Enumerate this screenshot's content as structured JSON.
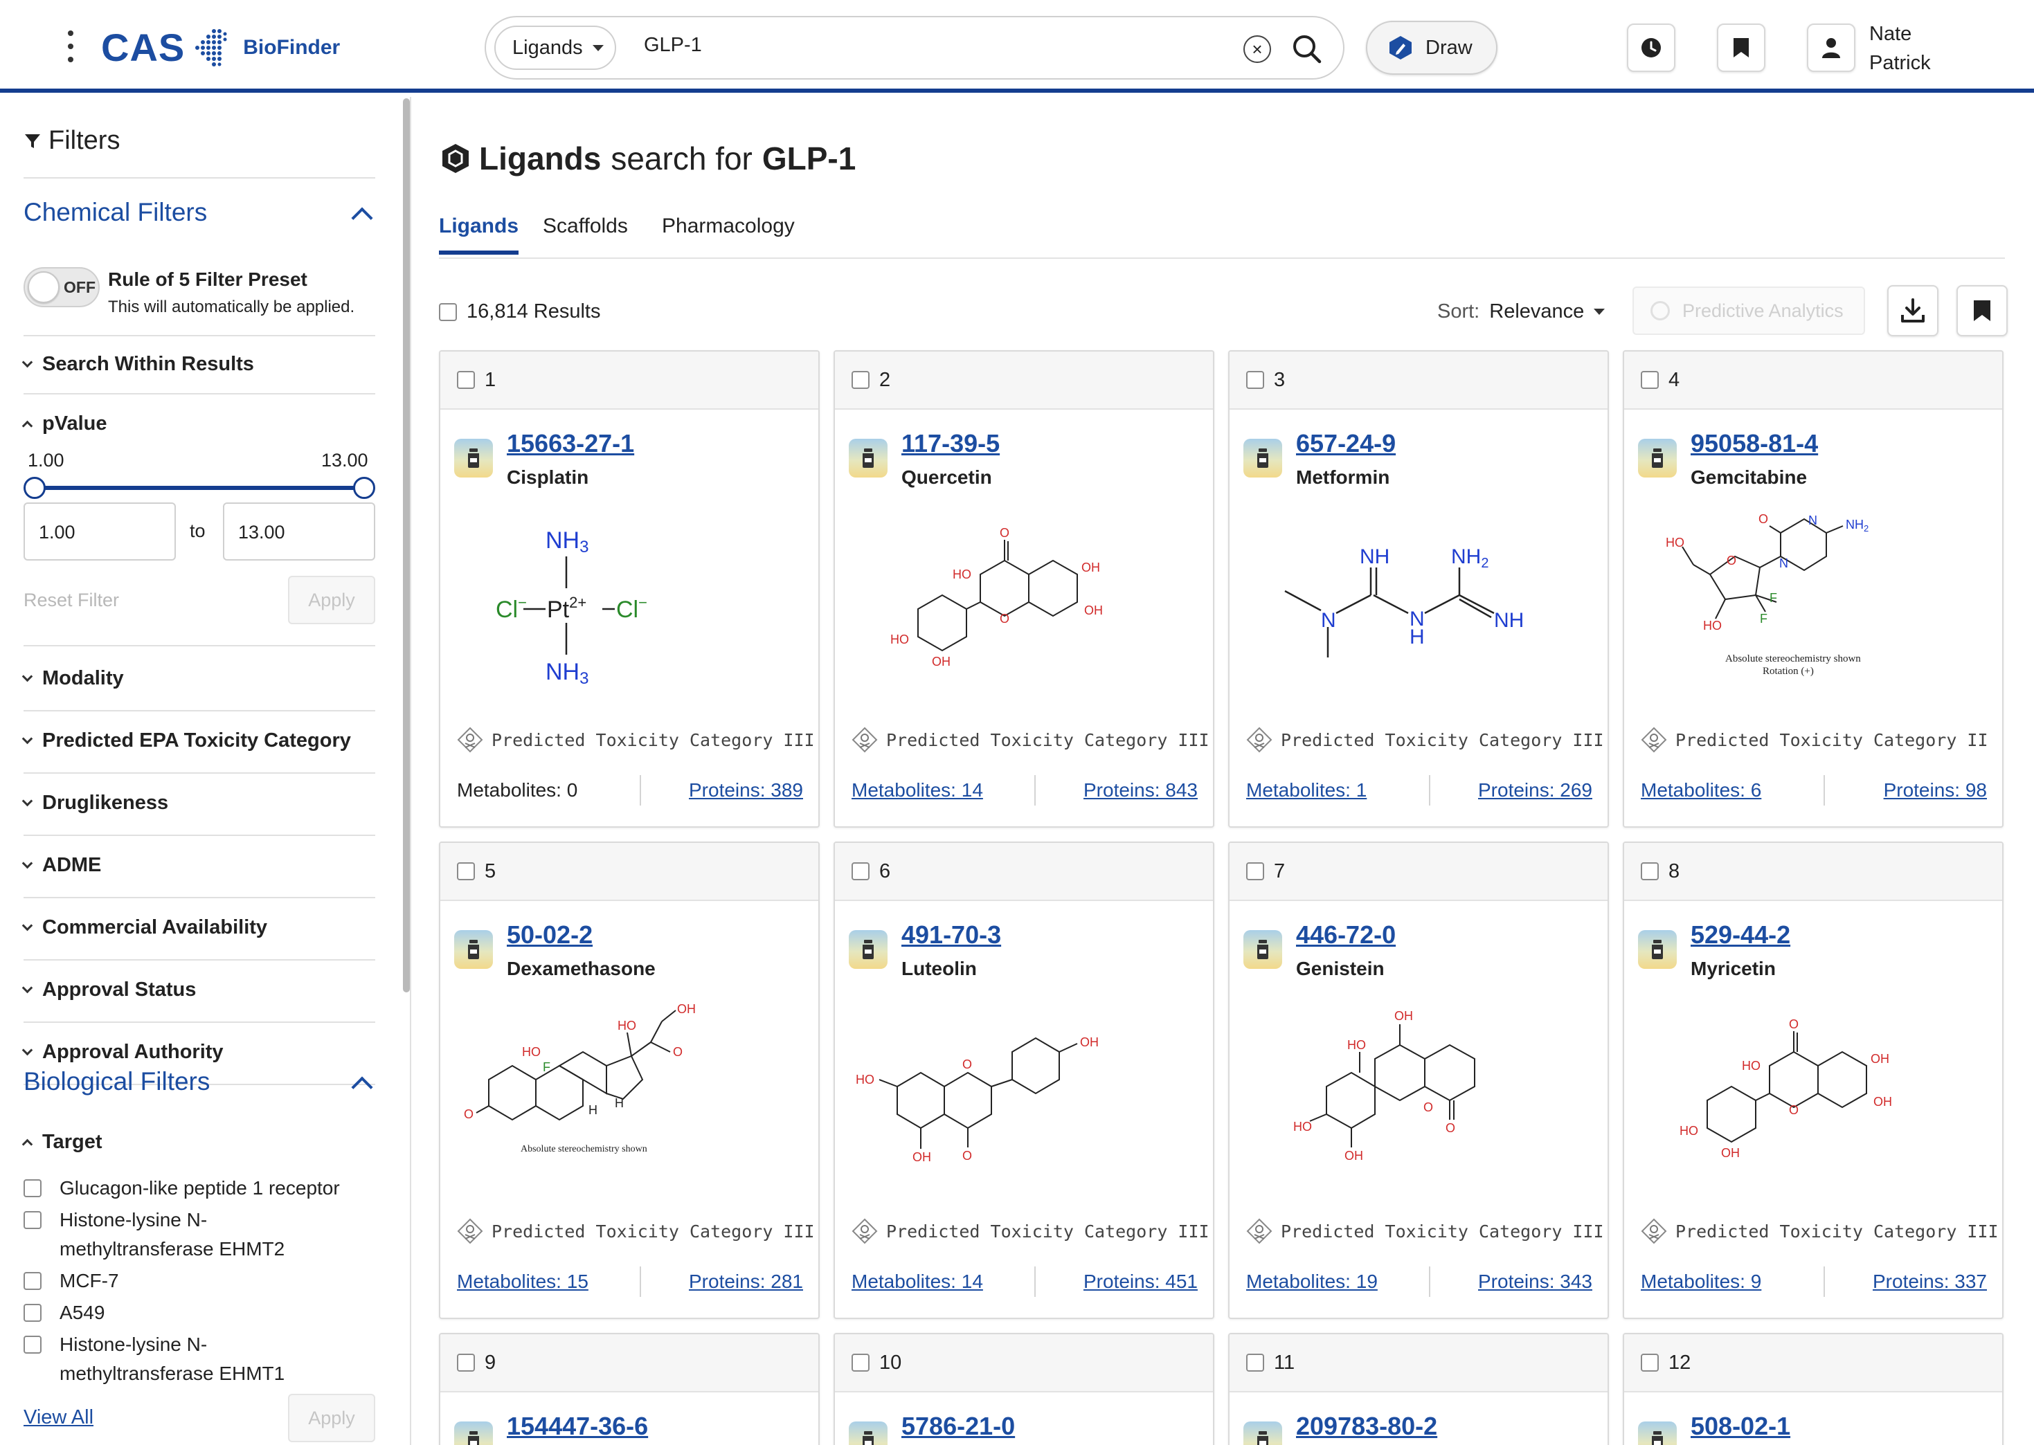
{
  "header": {
    "logo_text": "CAS",
    "logo_sub": "BioFinder",
    "search_type": "Ligands",
    "search_value": "GLP-1",
    "draw_label": "Draw",
    "user_first": "Nate",
    "user_last": "Patrick",
    "accent": "#143d8f"
  },
  "sidebar": {
    "title": "Filters",
    "chemical_title": "Chemical Filters",
    "toggle_state": "OFF",
    "preset_title": "Rule of 5 Filter Preset",
    "preset_sub": "This will automatically be applied.",
    "search_within": "Search Within Results",
    "pvalue": {
      "label": "pValue",
      "min_label": "1.00",
      "max_label": "13.00",
      "from": "1.00",
      "to_word": "to",
      "to": "13.00",
      "reset": "Reset Filter",
      "apply": "Apply"
    },
    "collapsed": [
      "Modality",
      "Predicted EPA Toxicity Category",
      "Druglikeness",
      "ADME",
      "Commercial Availability",
      "Approval Status",
      "Approval Authority"
    ],
    "bio_title": "Biological Filters",
    "target": {
      "label": "Target",
      "items": [
        {
          "line1": "Glucagon-like peptide 1 receptor",
          "line2": ""
        },
        {
          "line1": "Histone-lysine N-",
          "line2": "methyltransferase EHMT2"
        },
        {
          "line1": "MCF-7",
          "line2": ""
        },
        {
          "line1": "A549",
          "line2": ""
        },
        {
          "line1": "Histone-lysine N-",
          "line2": "methyltransferase EHMT1"
        }
      ],
      "view_all": "View All",
      "apply": "Apply"
    }
  },
  "main": {
    "title_bold": "Ligands",
    "title_mid": "search for",
    "title_query": "GLP-1",
    "tabs": [
      "Ligands",
      "Scaffolds",
      "Pharmacology"
    ],
    "results": "16,814 Results",
    "sort_label": "Sort:",
    "sort_value": "Relevance",
    "predictive": "Predictive Analytics",
    "cards": [
      {
        "num": "1",
        "cas": "15663-27-1",
        "name": "Cisplatin",
        "tox": "Predicted Toxicity Category III",
        "metabolites": "Metabolites: 0",
        "proteins": "Proteins: 389"
      },
      {
        "num": "2",
        "cas": "117-39-5",
        "name": "Quercetin",
        "tox": "Predicted Toxicity Category III",
        "metabolites": "Metabolites: 14",
        "proteins": "Proteins: 843"
      },
      {
        "num": "3",
        "cas": "657-24-9",
        "name": "Metformin",
        "tox": "Predicted Toxicity Category III",
        "metabolites": "Metabolites: 1",
        "proteins": "Proteins: 269"
      },
      {
        "num": "4",
        "cas": "95058-81-4",
        "name": "Gemcitabine",
        "tox": "Predicted Toxicity Category II",
        "metabolites": "Metabolites: 6",
        "proteins": "Proteins: 98"
      },
      {
        "num": "5",
        "cas": "50-02-2",
        "name": "Dexamethasone",
        "tox": "Predicted Toxicity Category III",
        "metabolites": "Metabolites: 15",
        "proteins": "Proteins: 281"
      },
      {
        "num": "6",
        "cas": "491-70-3",
        "name": "Luteolin",
        "tox": "Predicted Toxicity Category III",
        "metabolites": "Metabolites: 14",
        "proteins": "Proteins: 451"
      },
      {
        "num": "7",
        "cas": "446-72-0",
        "name": "Genistein",
        "tox": "Predicted Toxicity Category III",
        "metabolites": "Metabolites: 19",
        "proteins": "Proteins: 343"
      },
      {
        "num": "8",
        "cas": "529-44-2",
        "name": "Myricetin",
        "tox": "Predicted Toxicity Category III",
        "metabolites": "Metabolites: 9",
        "proteins": "Proteins: 337"
      },
      {
        "num": "9",
        "cas": "154447-36-6"
      },
      {
        "num": "10",
        "cas": "5786-21-0"
      },
      {
        "num": "11",
        "cas": "209783-80-2"
      },
      {
        "num": "12",
        "cas": "508-02-1"
      }
    ],
    "structure_notes": {
      "gemcitabine_note1": "Absolute stereochemistry shown",
      "gemcitabine_note2": "Rotation (+)",
      "dexamethasone_note": "Absolute stereochemistry shown"
    }
  }
}
